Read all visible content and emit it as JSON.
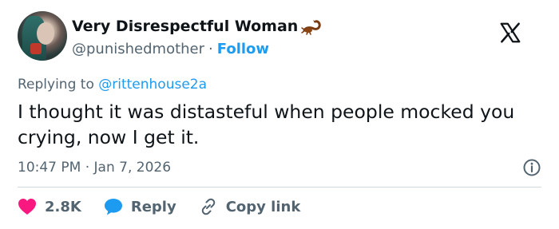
{
  "author": {
    "display_name": "Very Disrespectful Woman",
    "handle": "@punishedmother",
    "separator": "·",
    "follow_label": "Follow",
    "name_emoji_icon": "scorpion-icon"
  },
  "logo_icon": "x-logo-icon",
  "reply": {
    "prefix": "Replying to",
    "mention": "@rittenhouse2a"
  },
  "tweet": {
    "text": "I thought it was distasteful when people mocked you crying, now I get it.",
    "time": "10:47 PM",
    "separator": "·",
    "date": "Jan 7, 2026"
  },
  "actions": {
    "likes_count": "2.8K",
    "reply_label": "Reply",
    "copy_link_label": "Copy link"
  },
  "colors": {
    "like": "#f91880",
    "reply": "#1d9bf0",
    "link": "#1d9bf0",
    "muted": "#536471",
    "text": "#0f1419"
  }
}
